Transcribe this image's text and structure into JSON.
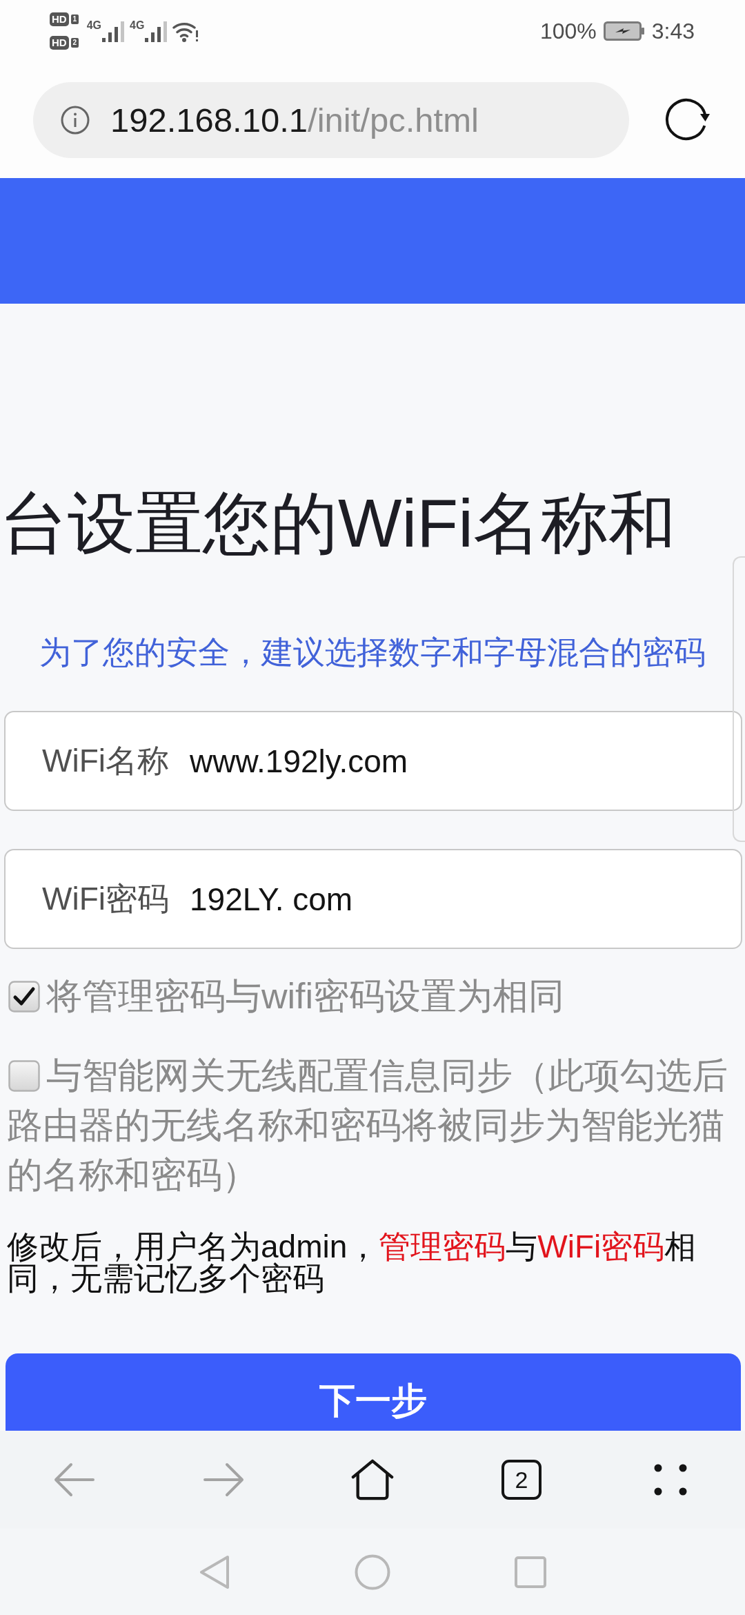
{
  "status_bar": {
    "sim_indicators": [
      {
        "label": "HD",
        "slot": "1"
      },
      {
        "label": "HD",
        "slot": "2"
      }
    ],
    "networks": [
      "4G",
      "4G"
    ],
    "battery": "100%",
    "time": "3:43"
  },
  "address_bar": {
    "host": "192.168.10.1",
    "path": "/init/pc.html"
  },
  "page": {
    "title": "台设置您的WiFi名称和",
    "hint": "为了您的安全，建议选择数字和字母混合的密码",
    "fields": [
      {
        "label": "WiFi名称",
        "value": "www.192ly.com"
      },
      {
        "label": "WiFi密码",
        "value": "192LY. com"
      }
    ],
    "options": [
      {
        "label": "将管理密码与wifi密码设置为相同",
        "checked": true
      },
      {
        "label": "与智能网关无线配置信息同步（此项勾选后路由器的无线名称和密码将被同步为智能光猫的名称和密码）",
        "checked": false
      }
    ],
    "notice": [
      {
        "text": "修改后，用户名为admin，",
        "highlight": false
      },
      {
        "text": "管理密码",
        "highlight": true
      },
      {
        "text": "与",
        "highlight": false
      },
      {
        "text": "WiFi密码",
        "highlight": true
      },
      {
        "text": "相同，无需记忆多个密码",
        "highlight": false
      }
    ],
    "next_button": "下一步"
  },
  "browser_toolbar": {
    "buttons": [
      {
        "kind": "back",
        "disabled": true
      },
      {
        "kind": "forward",
        "disabled": true
      },
      {
        "kind": "home",
        "disabled": false
      },
      {
        "kind": "tabs",
        "label": "2",
        "disabled": false
      },
      {
        "kind": "menu",
        "disabled": false
      }
    ]
  }
}
